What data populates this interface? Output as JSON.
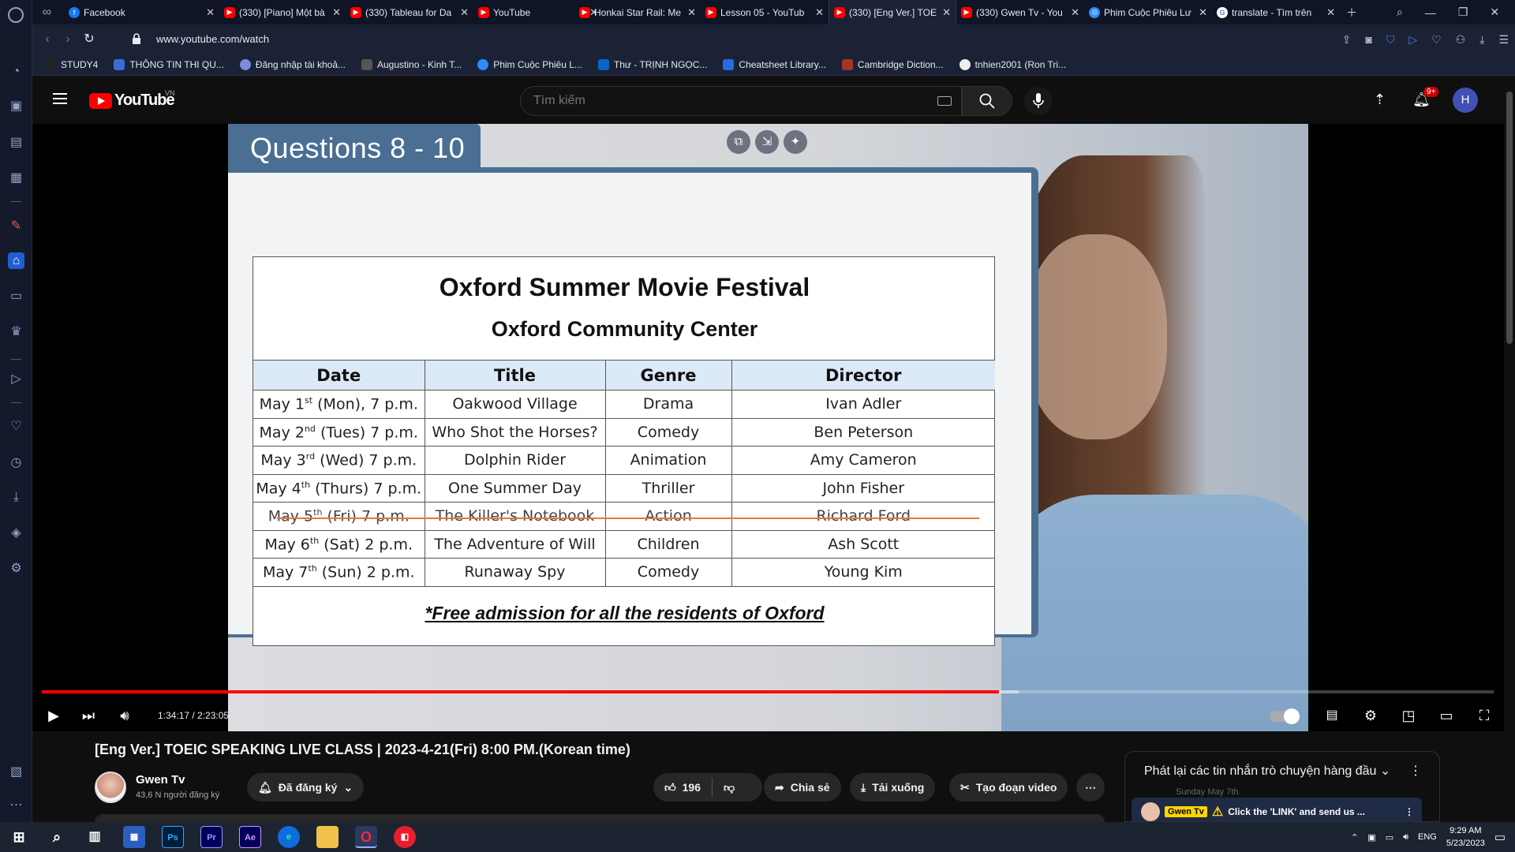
{
  "browser": {
    "tabs": [
      {
        "label": "Facebook",
        "icon": "facebook-icon",
        "active": false
      },
      {
        "label": "(330) [Piano] Một bà",
        "icon": "youtube-icon",
        "active": false
      },
      {
        "label": "(330) Tableau for Da",
        "icon": "youtube-icon",
        "active": false
      },
      {
        "label": "YouTube",
        "icon": "youtube-icon",
        "active": false
      },
      {
        "label": "Honkai Star Rail: Me",
        "icon": "youtube-icon",
        "active": false
      },
      {
        "label": "Lesson 05 - YouTub",
        "icon": "youtube-icon",
        "active": false
      },
      {
        "label": "(330) [Eng Ver.] TOE",
        "icon": "youtube-icon",
        "active": true
      },
      {
        "label": "(330) Gwen Tv - You",
        "icon": "youtube-icon",
        "active": false
      },
      {
        "label": "Phim Cuộc Phiêu Lư",
        "icon": "globe-icon",
        "active": false
      },
      {
        "label": "translate - Tìm trên",
        "icon": "google-icon",
        "active": false
      }
    ],
    "url": "www.youtube.com/watch",
    "bookmarks": [
      {
        "label": "STUDY4"
      },
      {
        "label": "THÔNG TIN THI QU..."
      },
      {
        "label": "Đăng nhập tài khoả..."
      },
      {
        "label": "Augustino - Kinh T..."
      },
      {
        "label": "Phim Cuộc Phiêu L..."
      },
      {
        "label": "Thư - TRỊNH NGỌC..."
      },
      {
        "label": "Cheatsheet Library..."
      },
      {
        "label": "Cambridge Diction..."
      },
      {
        "label": "tnhien2001 (Ron Tri..."
      }
    ]
  },
  "youtube": {
    "logo_text": "YouTube",
    "country": "VN",
    "search_placeholder": "Tìm kiếm",
    "notification_count": "9+",
    "avatar_letter": "H"
  },
  "slide": {
    "questions": "Questions 8 - 10",
    "title": "Oxford Summer Movie Festival",
    "subtitle": "Oxford Community Center",
    "headers": [
      "Date",
      "Title",
      "Genre",
      "Director"
    ],
    "rows": [
      {
        "date_pre": "May 1",
        "sup": "st",
        "date_post": " (Mon), 7 p.m.",
        "title": "Oakwood Village",
        "genre": "Drama",
        "director": "Ivan Adler"
      },
      {
        "date_pre": "May 2",
        "sup": "nd",
        "date_post": " (Tues) 7 p.m.",
        "title": "Who Shot the Horses?",
        "genre": "Comedy",
        "director": "Ben Peterson"
      },
      {
        "date_pre": "May 3",
        "sup": "rd",
        "date_post": " (Wed) 7 p.m.",
        "title": "Dolphin Rider",
        "genre": "Animation",
        "director": "Amy Cameron"
      },
      {
        "date_pre": "May 4",
        "sup": "th",
        "date_post": " (Thurs) 7 p.m.",
        "title": "One Summer Day",
        "genre": "Thriller",
        "director": "John Fisher"
      },
      {
        "date_pre": "May 5",
        "sup": "th",
        "date_post": " (Fri) 7 p.m.",
        "title": "The Killer's Notebook",
        "genre": "Action",
        "director": "Richard Ford"
      },
      {
        "date_pre": "May 6",
        "sup": "th",
        "date_post": " (Sat) 2 p.m.",
        "title": "The Adventure of Will",
        "genre": "Children",
        "director": "Ash Scott"
      },
      {
        "date_pre": "May 7",
        "sup": "th",
        "date_post": " (Sun) 2 p.m.",
        "title": "Runaway Spy",
        "genre": "Comedy",
        "director": "Young Kim"
      }
    ],
    "note": "*Free admission for all the residents of Oxford"
  },
  "player": {
    "time": "1:34:17 / 2:23:05",
    "progress": 0.659,
    "buffered": 0.673
  },
  "video": {
    "title": "[Eng Ver.] TOEIC SPEAKING LIVE CLASS | 2023-4-21(Fri) 8:00 PM.(Korean time)",
    "channel": "Gwen Tv",
    "subscribers": "43,6 N người đăng ký",
    "subscribed_label": "Đã đăng ký",
    "likes": "196",
    "share_label": "Chia sẻ",
    "download_label": "Tải xuống",
    "clip_label": "Tạo đoạn video"
  },
  "chat": {
    "header": "Phát lại các tin nhắn trò chuyện hàng đầu",
    "faded_text": "Sunday May 7th.",
    "msg_author": "Gwen Tv",
    "msg_text": "Click the 'LINK' and send us ..."
  },
  "taskbar": {
    "lang": "ENG",
    "time": "9:29 AM",
    "date": "5/23/2023"
  }
}
